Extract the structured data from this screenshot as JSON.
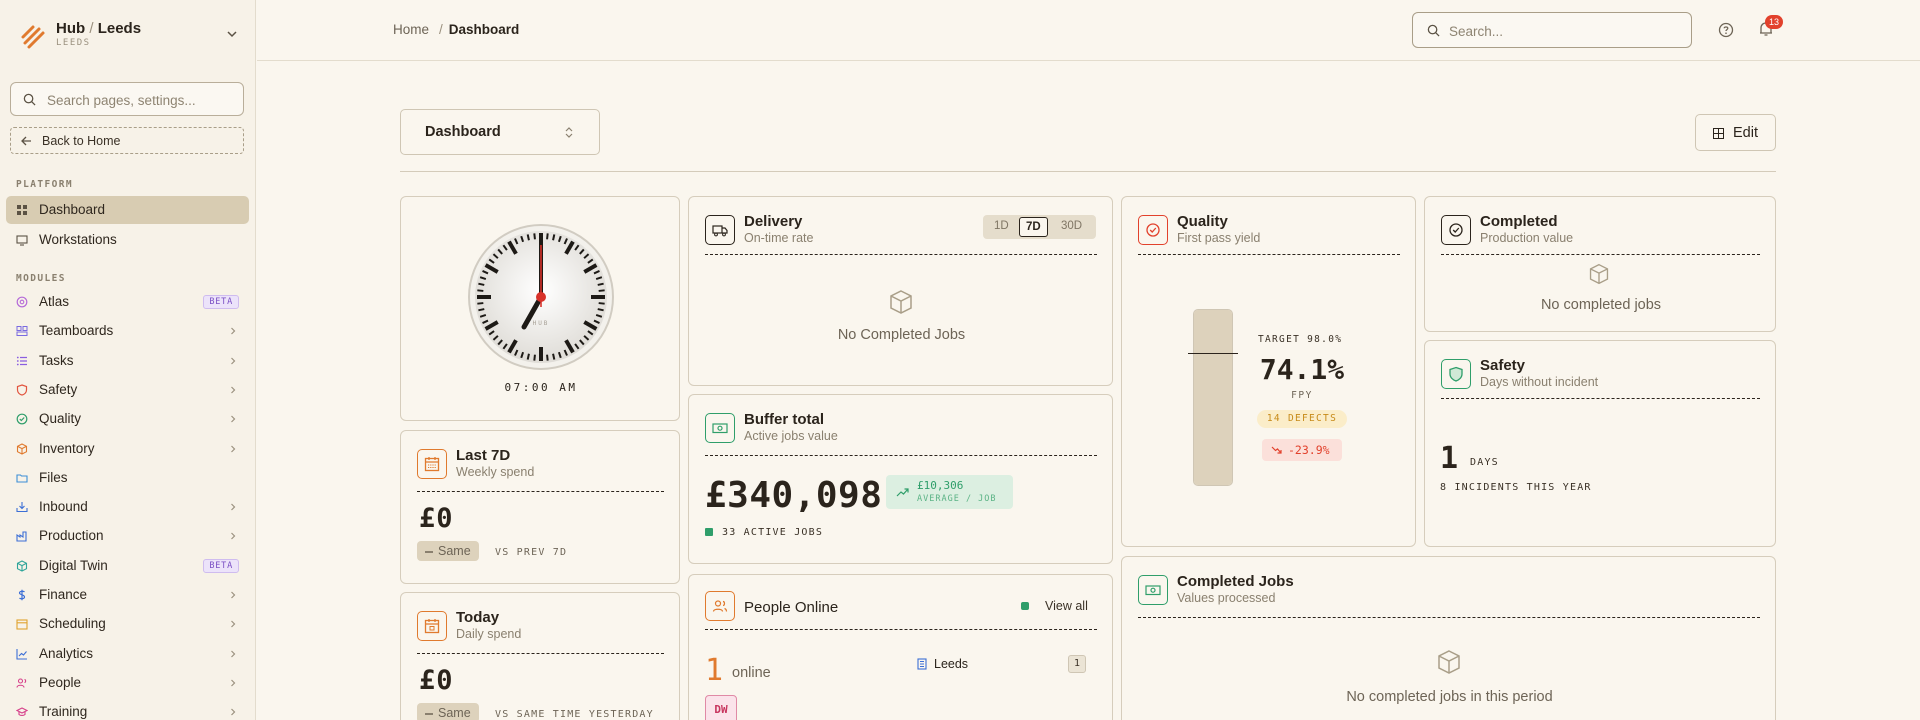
{
  "org": {
    "name": "Hub",
    "location": "Leeds",
    "sub": "LEEDS"
  },
  "sidebar": {
    "search_placeholder": "Search pages, settings...",
    "back_label": "Back to Home",
    "platform_label": "PLATFORM",
    "modules_label": "MODULES",
    "platform_items": [
      {
        "label": "Dashboard",
        "icon": "grid-icon",
        "active": true
      },
      {
        "label": "Workstations",
        "icon": "workstation-icon"
      }
    ],
    "module_items": [
      {
        "label": "Atlas",
        "icon": "atlas-icon",
        "color": "#b56ad8",
        "badge": "BETA"
      },
      {
        "label": "Teamboards",
        "icon": "teamboards-icon",
        "color": "#7a6ae0"
      },
      {
        "label": "Tasks",
        "icon": "tasks-icon",
        "color": "#8a5ee0"
      },
      {
        "label": "Safety",
        "icon": "shield-icon",
        "color": "#e2553f"
      },
      {
        "label": "Quality",
        "icon": "check-circle-icon",
        "color": "#2f9e6a"
      },
      {
        "label": "Inventory",
        "icon": "box-icon",
        "color": "#e07a2e"
      },
      {
        "label": "Files",
        "icon": "folder-icon",
        "color": "#3c8fd6"
      },
      {
        "label": "Inbound",
        "icon": "inbound-icon",
        "color": "#3c6fd6"
      },
      {
        "label": "Production",
        "icon": "factory-icon",
        "color": "#3c6fd6"
      },
      {
        "label": "Digital Twin",
        "icon": "cube-icon",
        "color": "#2fa59a",
        "badge": "BETA"
      },
      {
        "label": "Finance",
        "icon": "dollar-icon",
        "color": "#3c6fd6"
      },
      {
        "label": "Scheduling",
        "icon": "calendar-icon",
        "color": "#e0a22e"
      },
      {
        "label": "Analytics",
        "icon": "chart-icon",
        "color": "#3c6fd6"
      },
      {
        "label": "People",
        "icon": "people-icon",
        "color": "#d6408a"
      },
      {
        "label": "Training",
        "icon": "training-icon",
        "color": "#d6408a"
      }
    ]
  },
  "header": {
    "breadcrumb_home": "Home",
    "breadcrumb_sep": "/",
    "breadcrumb_current": "Dashboard",
    "search_placeholder": "Search...",
    "notification_count": "13"
  },
  "main": {
    "dashboard_select": "Dashboard",
    "edit_label": "Edit",
    "clock": {
      "time": "07:00 AM",
      "face_label": "HUB"
    },
    "last7d": {
      "title": "Last 7D",
      "sub": "Weekly spend",
      "value": "£0",
      "badge": "Same",
      "compare": "VS PREV 7D"
    },
    "today": {
      "title": "Today",
      "sub": "Daily spend",
      "value": "£0",
      "badge": "Same",
      "compare": "VS SAME TIME YESTERDAY"
    },
    "delivery": {
      "title": "Delivery",
      "sub": "On-time rate",
      "ranges": [
        "1D",
        "7D",
        "30D"
      ],
      "empty": "No Completed Jobs"
    },
    "buffer": {
      "title": "Buffer total",
      "sub": "Active jobs value",
      "value": "£340,098",
      "avg_value": "£10,306",
      "avg_label": "AVERAGE / JOB",
      "active": "33 ACTIVE JOBS"
    },
    "people": {
      "title": "People Online",
      "view_all": "View all",
      "count": "1",
      "count_label": "online",
      "site": "Leeds",
      "site_count": "1",
      "avatar": "DW"
    },
    "quality": {
      "title": "Quality",
      "sub": "First pass yield",
      "target": "TARGET 98.0%",
      "value": "74.1%",
      "unit": "FPY",
      "defects": "14 DEFECTS",
      "delta": "-23.9%",
      "fill_fraction": 1.0,
      "target_fraction": 0.98
    },
    "completed": {
      "title": "Completed",
      "sub": "Production value",
      "empty": "No completed jobs"
    },
    "safety": {
      "title": "Safety",
      "sub": "Days without incident",
      "days": "1",
      "days_label": "DAYS",
      "incidents": "8 INCIDENTS THIS YEAR"
    },
    "completed_jobs": {
      "title": "Completed Jobs",
      "sub": "Values processed",
      "empty": "No completed jobs in this period"
    }
  },
  "colors": {
    "accent": "#e07a2e",
    "active_nav": "#d8ccb2",
    "positive": "#2f9e6a",
    "negative": "#e2412c"
  }
}
